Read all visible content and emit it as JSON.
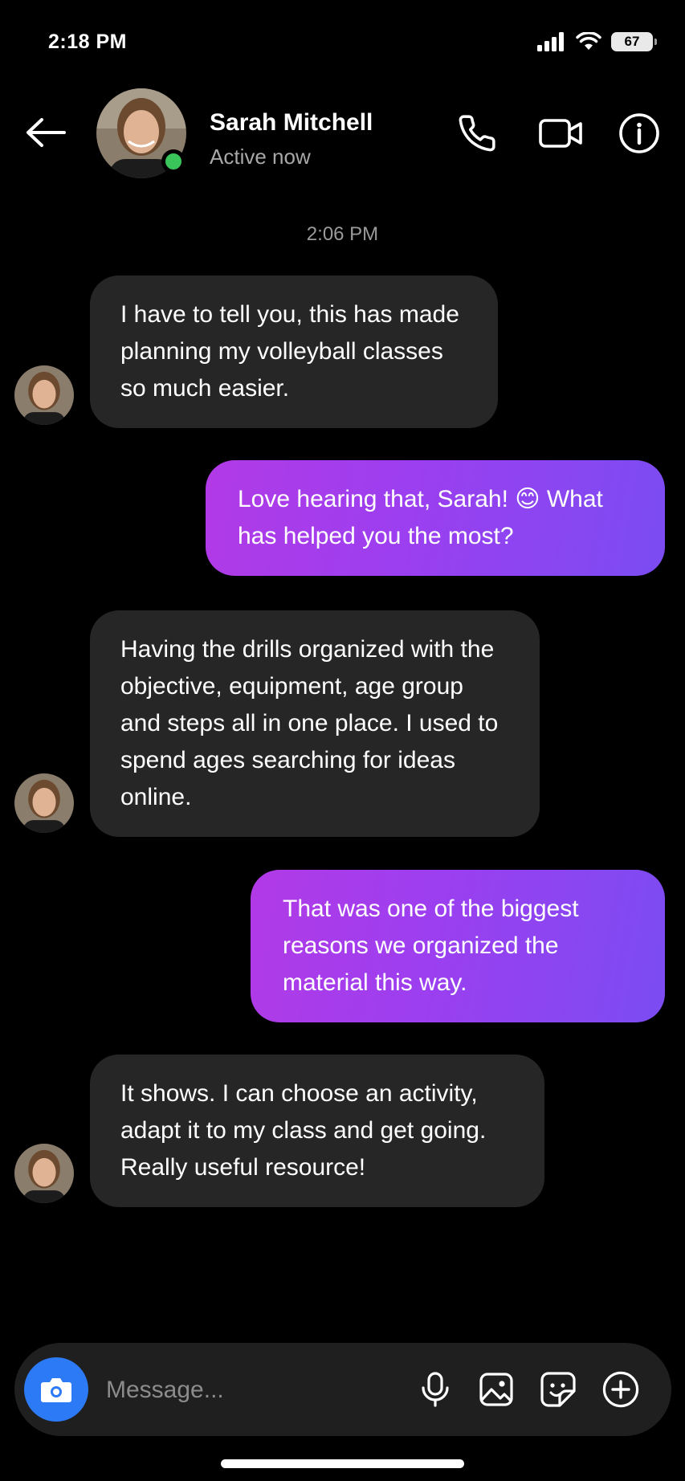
{
  "status_bar": {
    "time": "2:18 PM",
    "battery": "67"
  },
  "header": {
    "contact_name": "Sarah Mitchell",
    "contact_status": "Active now"
  },
  "conversation": {
    "timestamp": "2:06 PM",
    "messages": [
      {
        "direction": "incoming",
        "text": "I have to tell you, this has made planning my volleyball classes so much easier."
      },
      {
        "direction": "outgoing",
        "text": "Love hearing that, Sarah! 😊 What has helped you the most?"
      },
      {
        "direction": "incoming",
        "text": "Having the drills organized with the objective, equipment, age group and steps all in one place. I used to spend ages searching for ideas online."
      },
      {
        "direction": "outgoing",
        "text": "That was one of the biggest reasons we organized the material this way."
      },
      {
        "direction": "incoming",
        "text": "It shows. I can choose an activity, adapt it to my class and get going. Really useful resource!"
      }
    ]
  },
  "composer": {
    "placeholder": "Message..."
  },
  "colors": {
    "accent_start": "#b23ae6",
    "accent_end": "#7b4cf2",
    "camera_button": "#2d7af6",
    "online": "#3ac55a",
    "incoming_bubble": "#262626"
  },
  "icons": [
    "back-arrow-icon",
    "phone-icon",
    "video-camera-icon",
    "info-icon",
    "camera-icon",
    "microphone-icon",
    "gallery-icon",
    "sticker-icon",
    "plus-circle-icon"
  ]
}
